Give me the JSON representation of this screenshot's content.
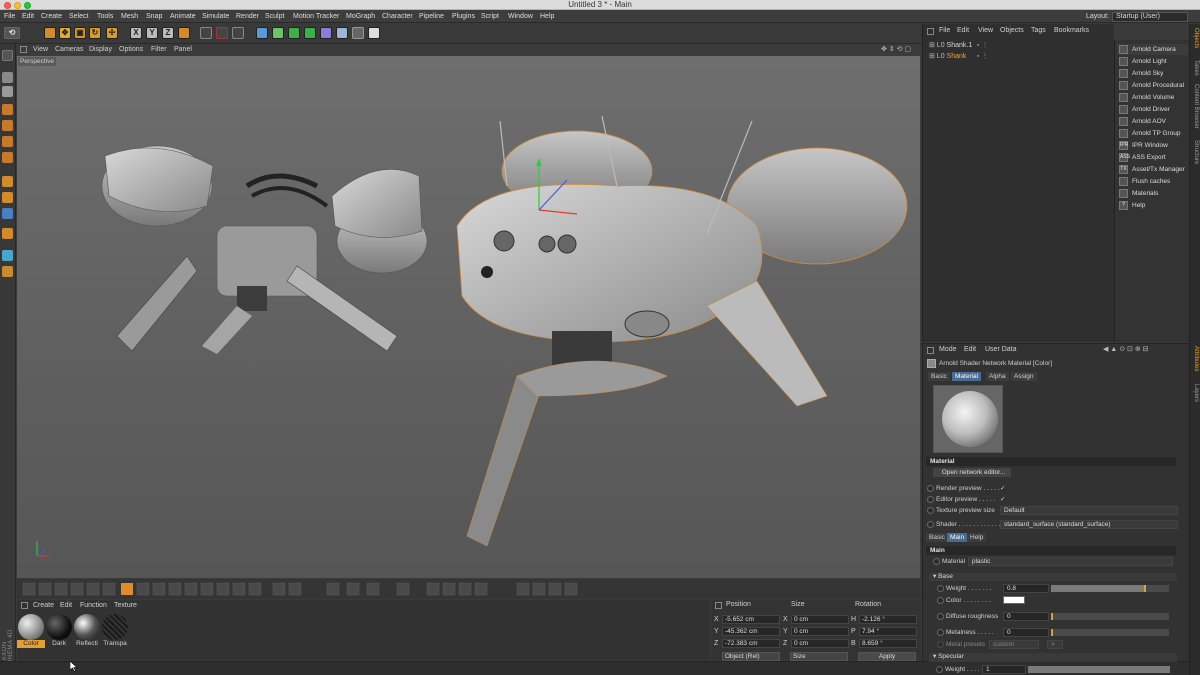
{
  "window": {
    "title": "Untitled 3 * - Main"
  },
  "menubar": {
    "items": [
      "File",
      "Edit",
      "Create",
      "Select",
      "Tools",
      "Mesh",
      "Snap",
      "Animate",
      "Simulate",
      "Render",
      "Sculpt",
      "Motion Tracker",
      "MoGraph",
      "Character",
      "Pipeline",
      "Plugins",
      "Script",
      "Window",
      "Help"
    ],
    "layout_label": "Layout:",
    "layout_value": "Startup (User)"
  },
  "viewport": {
    "menu": [
      "View",
      "Cameras",
      "Display",
      "Options",
      "Filter",
      "Panel"
    ],
    "label": "Perspective"
  },
  "material_manager": {
    "menu": [
      "Create",
      "Edit",
      "Function",
      "Texture"
    ],
    "materials": [
      {
        "name": "Color",
        "selected": true
      },
      {
        "name": "Dark",
        "selected": false
      },
      {
        "name": "Reflecti",
        "selected": false
      },
      {
        "name": "Transpa",
        "selected": false
      }
    ],
    "branding": "MAXON CINEMA 4D"
  },
  "coordinates": {
    "headers": {
      "position": "Position",
      "size": "Size",
      "rotation": "Rotation"
    },
    "rows": [
      {
        "axis": "X",
        "pos": "-5.652 cm",
        "size_axis": "X",
        "size": "0 cm",
        "rot_axis": "H",
        "rot": "-2.126 °"
      },
      {
        "axis": "Y",
        "pos": "-45.362 cm",
        "size_axis": "Y",
        "size": "0 cm",
        "rot_axis": "P",
        "rot": "7.94 °"
      },
      {
        "axis": "Z",
        "pos": "-72.383 cm",
        "size_axis": "Z",
        "size": "0 cm",
        "rot_axis": "B",
        "rot": "8.659 °"
      }
    ],
    "mode": "Object (Rel)",
    "size_mode": "Size",
    "apply": "Apply"
  },
  "object_manager": {
    "menu": [
      "File",
      "Edit",
      "View",
      "Objects",
      "Tags",
      "Bookmarks"
    ],
    "objects": [
      {
        "name": "Shank.1",
        "selected": false
      },
      {
        "name": "Shank",
        "selected": true
      }
    ]
  },
  "arnold_menu": {
    "items": [
      {
        "label": "Arnold Camera",
        "icon": "camera-icon"
      },
      {
        "label": "Arnold Light",
        "icon": "light-icon"
      },
      {
        "label": "Arnold Sky",
        "icon": "sky-icon"
      },
      {
        "label": "Arnold Procedural",
        "icon": "procedural-icon"
      },
      {
        "label": "Arnold Volume",
        "icon": "volume-icon"
      },
      {
        "label": "Arnold Driver",
        "icon": "driver-icon"
      },
      {
        "label": "Arnold AOV",
        "icon": "aov-icon"
      },
      {
        "label": "Arnold TP Group",
        "icon": "tp-group-icon"
      },
      {
        "label": "IPR Window",
        "icon": "ipr-icon",
        "glyph": "IPR"
      },
      {
        "label": "ASS Export",
        "icon": "ass-icon",
        "glyph": "ASS"
      },
      {
        "label": "Asset/Tx Manager",
        "icon": "tx-icon",
        "glyph": "TX"
      },
      {
        "label": "Flush caches",
        "icon": "flush-icon"
      },
      {
        "label": "Materials",
        "icon": "materials-icon"
      },
      {
        "label": "Help",
        "icon": "help-icon",
        "glyph": "?"
      }
    ]
  },
  "side_tabs": [
    "Objects",
    "Takes",
    "Content Browser",
    "Structure",
    "Attributes",
    "Layers"
  ],
  "attributes": {
    "menu": [
      "Mode",
      "Edit",
      "User Data"
    ],
    "title": "Arnold Shader Network Material [Color]",
    "tabs": [
      "Basic",
      "Material",
      "Alpha",
      "Assign"
    ],
    "active_tab": "Material",
    "section_material": "Material",
    "open_editor": "Open network editor...",
    "render_preview": "Render preview . . . . .",
    "editor_preview": "Editor preview . . . . .",
    "texture_preview_size": "Texture preview size",
    "texture_preview_value": "Default",
    "shader_label": "Shader . . . . . . . . . . . . .",
    "shader_value": "standard_surface (standard_surface)",
    "subtabs": [
      "Basic",
      "Main",
      "Help"
    ],
    "active_subtab": "Main",
    "section_main": "Main",
    "material_label": "Material",
    "material_value": "plastic",
    "group_base": "Base",
    "weight_label": "Weight . . . . . . .",
    "weight_value": "0.8",
    "weight_fraction": 0.8,
    "color_label": "Color . . . . . . . .",
    "color_swatch": "#ffffff",
    "diffuse_label": "Diffuse roughness",
    "diffuse_value": "0",
    "metalness_label": "Metalness . . . . .",
    "metalness_value": "0",
    "metal_presets_label": "Metal presets",
    "metal_presets_value": "custom",
    "group_specular": "Specular",
    "spec_weight_label": "Weight . . . . . . .",
    "spec_weight_value": "1"
  },
  "colors": {
    "accent": "#e5a033",
    "selected_object": "#f0a030",
    "tab_active": "#4b6b93"
  }
}
